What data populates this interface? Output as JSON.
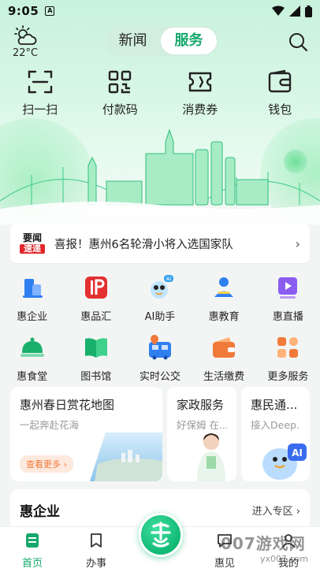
{
  "status_bar": {
    "time": "9:05",
    "notif_letter": "A"
  },
  "weather": {
    "temperature": "22°C",
    "icon": "partly-cloudy-icon"
  },
  "segment": {
    "tabs": [
      "新闻",
      "服务"
    ],
    "active": "服务"
  },
  "quick_actions": [
    {
      "label": "扫一扫",
      "icon": "scan-icon"
    },
    {
      "label": "付款码",
      "icon": "qr-code-icon"
    },
    {
      "label": "消费券",
      "icon": "coupon-icon"
    },
    {
      "label": "钱包",
      "icon": "wallet-icon"
    }
  ],
  "news": {
    "badge_top": "要闻",
    "badge_bottom": "速递",
    "headline": "喜报！惠州6名轮滑小将入选国家队"
  },
  "services": [
    {
      "label": "惠企业",
      "icon": "enterprise-icon",
      "color": "#2f7ff0"
    },
    {
      "label": "惠品汇",
      "icon": "hp-brand-icon",
      "color": "#e33030"
    },
    {
      "label": "AI助手",
      "icon": "ai-assistant-icon",
      "color": "#3aa3f0"
    },
    {
      "label": "惠教育",
      "icon": "education-icon",
      "color": "#2f7ff0"
    },
    {
      "label": "惠直播",
      "icon": "live-stream-icon",
      "color": "#8a5cf0"
    },
    {
      "label": "惠食堂",
      "icon": "canteen-icon",
      "color": "#19b06b"
    },
    {
      "label": "图书馆",
      "icon": "library-icon",
      "color": "#19b06b"
    },
    {
      "label": "实时公交",
      "icon": "bus-icon",
      "color": "#2f7ff0"
    },
    {
      "label": "生活缴费",
      "icon": "bill-payment-icon",
      "color": "#f07a3a"
    },
    {
      "label": "更多服务",
      "icon": "more-services-icon",
      "color": "#f07a3a"
    }
  ],
  "cards": [
    {
      "title": "惠州春日赏花地图",
      "sub": "一起奔赴花海",
      "more": "查看更多 ›"
    },
    {
      "title": "家政服务",
      "sub": "好保姆 在..."
    },
    {
      "title": "惠民通...",
      "sub": "接入Deep..."
    }
  ],
  "section": {
    "title": "惠企业",
    "link": "进入专区 ›"
  },
  "tabbar": [
    {
      "label": "首页",
      "icon": "home-icon",
      "active": true
    },
    {
      "label": "办事",
      "icon": "bookmark-icon",
      "active": false
    },
    {
      "label": "惠见",
      "icon": "chat-icon",
      "active": false
    },
    {
      "label": "我的",
      "icon": "profile-icon",
      "active": false
    }
  ],
  "watermark": {
    "text": "007游戏网",
    "url": "yx007.com"
  },
  "colors": {
    "brand": "#14a86a",
    "accent_orange": "#f07a3a",
    "badge_red": "#e3262a"
  }
}
